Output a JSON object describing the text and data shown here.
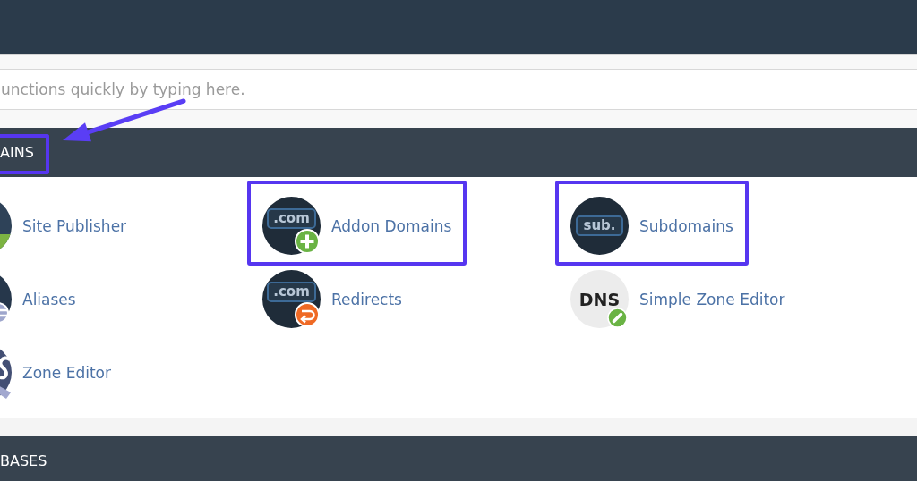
{
  "search": {
    "placeholder": "unctions quickly by typing here."
  },
  "sections": [
    {
      "title": "AINS",
      "highlighted": true,
      "items": [
        {
          "label": "Site Publisher",
          "kind": "publisher",
          "highlighted": false
        },
        {
          "label": "Addon Domains",
          "kind": "addon",
          "icon_text": ".com",
          "highlighted": true
        },
        {
          "label": "Subdomains",
          "kind": "subdomain",
          "icon_text": "sub.",
          "highlighted": true
        },
        {
          "label": "Aliases",
          "kind": "alias",
          "highlighted": false
        },
        {
          "label": "Redirects",
          "kind": "redirect",
          "icon_text": ".com",
          "highlighted": false
        },
        {
          "label": "Simple Zone Editor",
          "kind": "dns",
          "icon_text": "DNS",
          "highlighted": false
        },
        {
          "label": "Zone Editor",
          "kind": "zone",
          "highlighted": false
        }
      ]
    },
    {
      "title": "BASES",
      "highlighted": false
    }
  ]
}
